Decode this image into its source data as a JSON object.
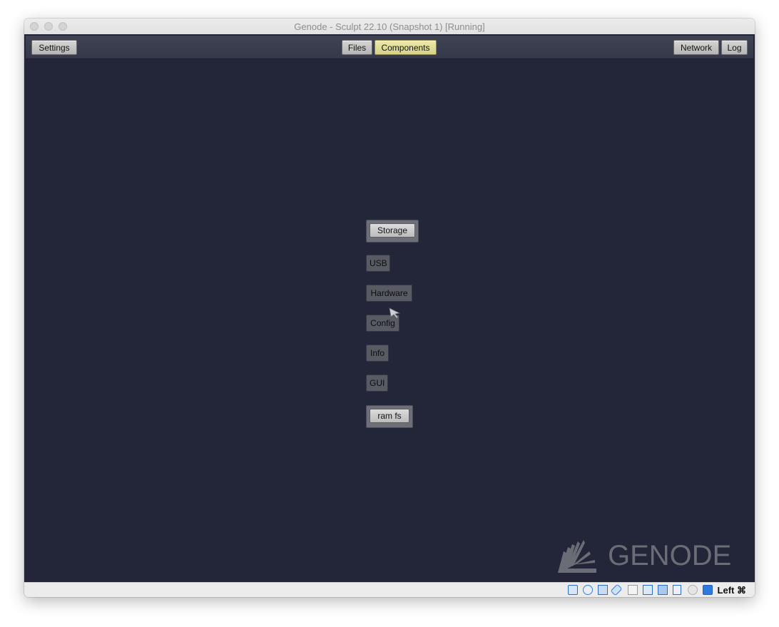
{
  "window": {
    "title": "Genode - Sculpt 22.10 (Snapshot 1) [Running]"
  },
  "topbar": {
    "settings_label": "Settings",
    "files_label": "Files",
    "components_label": "Components",
    "network_label": "Network",
    "log_label": "Log"
  },
  "graph": {
    "storage_label": "Storage",
    "usb_label": "USB",
    "hardware_label": "Hardware",
    "config_label": "Config",
    "info_label": "Info",
    "gui_label": "GUI",
    "ramfs_label": "ram fs"
  },
  "logo": {
    "text": "GENODE"
  },
  "statusbar": {
    "icons": [
      "hard-disk-icon",
      "optical-drive-icon",
      "network-icon",
      "usb-icon",
      "shared-folder-icon",
      "display-icon",
      "video-capture-icon",
      "cpu-icon",
      "mouse-integration-icon",
      "down-arrow-icon"
    ],
    "host_key": "Left ⌘"
  },
  "colors": {
    "desktop_bg": "#222638",
    "topbar_bg": "#3a3e4e",
    "selected_button": "#e0dc96",
    "logo_gray": "#6a6d76"
  }
}
